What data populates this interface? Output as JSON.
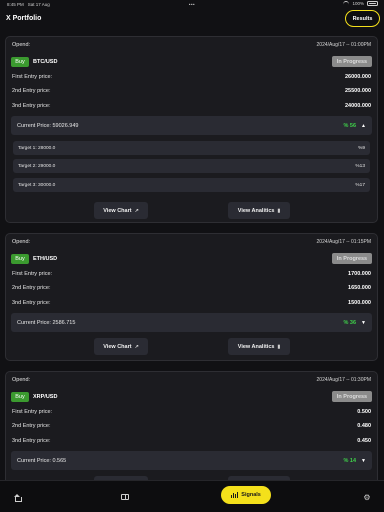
{
  "status_bar": {
    "time": "8:45 PM",
    "date": "Sat 17 Aug",
    "center": "•••",
    "battery": "100%"
  },
  "header": {
    "title": "X Portfolio",
    "results_label": "Results"
  },
  "labels": {
    "opened": "Opend:",
    "buy": "Buy",
    "in_progress": "In Progress",
    "first_entry": "First Entry price:",
    "second_entry": "2nd Entry price:",
    "third_entry": "3nd Entry price:",
    "current_price_prefix": "Current Price:",
    "view_chart": "View Chart",
    "view_analitics": "View Analitics"
  },
  "signals": [
    {
      "opened": "2024/Aug/17 -- 01:00PM",
      "action": "Buy",
      "pair": "BTC/USD",
      "status": "In Progress",
      "first_entry": "26000.000",
      "second_entry": "25500.000",
      "third_entry": "24000.000",
      "current_price": "Current Price: 59026.949",
      "change": "% 56",
      "expanded": true,
      "targets": [
        {
          "label": "Target 1: 28000.0",
          "pct": "%9"
        },
        {
          "label": "Target 2: 29000.0",
          "pct": "%13"
        },
        {
          "label": "Target 3: 30000.0",
          "pct": "%17"
        }
      ]
    },
    {
      "opened": "2024/Aug/17 -- 01:15PM",
      "action": "Buy",
      "pair": "ETH/USD",
      "status": "In Progress",
      "first_entry": "1700.000",
      "second_entry": "1650.000",
      "third_entry": "1500.000",
      "current_price": "Current Price: 2586.715",
      "change": "% 36",
      "expanded": false
    },
    {
      "opened": "2024/Aug/17 -- 01:30PM",
      "action": "Buy",
      "pair": "XRP/USD",
      "status": "In Progress",
      "first_entry": "0.500",
      "second_entry": "0.480",
      "third_entry": "0.450",
      "current_price": "Current Price: 0.565",
      "change": "% 14",
      "expanded": false
    }
  ],
  "tabs": {
    "signals_label": "Signals"
  },
  "colors": {
    "accent": "#f4e01b",
    "buy": "#3b9a2f",
    "positive": "#3fd24a",
    "card": "#1b1b1f"
  }
}
